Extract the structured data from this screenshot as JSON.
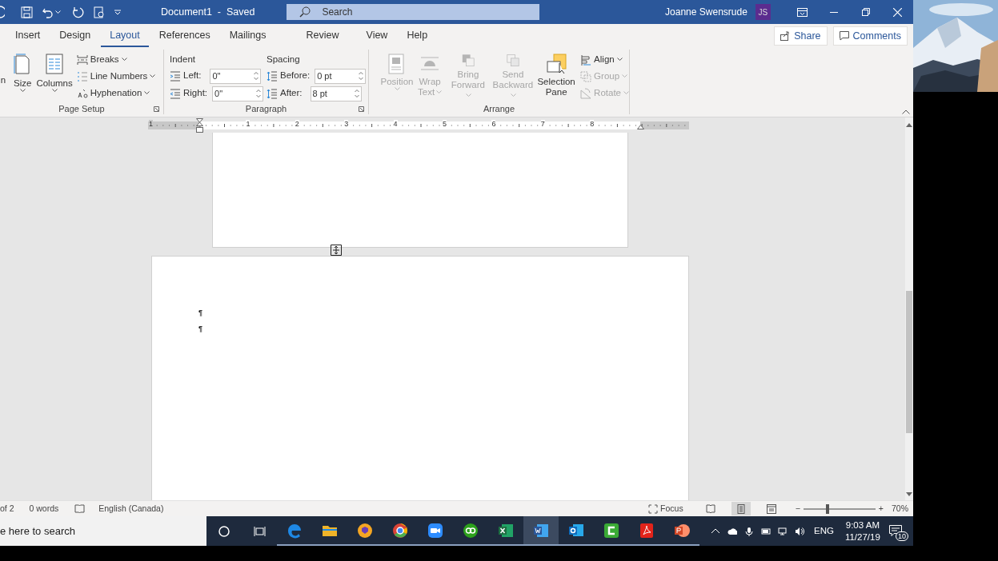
{
  "title_bar": {
    "document_title": "Document1  -  Saved",
    "search_placeholder": "Search",
    "user_name": "Joanne Swensrude",
    "user_initials": "JS"
  },
  "tabs": [
    {
      "label": "Insert",
      "selected": false
    },
    {
      "label": "Design",
      "selected": false
    },
    {
      "label": "Layout",
      "selected": true
    },
    {
      "label": "References",
      "selected": false
    },
    {
      "label": "Mailings",
      "selected": false
    },
    {
      "label": "Review",
      "selected": false
    },
    {
      "label": "View",
      "selected": false
    },
    {
      "label": "Help",
      "selected": false
    }
  ],
  "share": "Share",
  "comments": "Comments",
  "page_setup": {
    "cut_button": "n",
    "large": [
      {
        "label": "Size"
      },
      {
        "label": "Columns"
      }
    ],
    "small": [
      {
        "label": "Breaks"
      },
      {
        "label": "Line Numbers"
      },
      {
        "label": "Hyphenation"
      }
    ],
    "label": "Page Setup"
  },
  "paragraph": {
    "indent_heading": "Indent",
    "spacing_heading": "Spacing",
    "indent": [
      {
        "label": "Left:",
        "value": "0\""
      },
      {
        "label": "Right:",
        "value": "0\""
      }
    ],
    "spacing": [
      {
        "label": "Before:",
        "value": "0 pt"
      },
      {
        "label": "After:",
        "value": "8 pt"
      }
    ],
    "label": "Paragraph"
  },
  "arrange": {
    "large": [
      {
        "lines": [
          "Position"
        ],
        "disabled": true,
        "dropdown": true
      },
      {
        "lines": [
          "Wrap",
          "Text"
        ],
        "disabled": true,
        "dropdown": true
      },
      {
        "lines": [
          "Bring",
          "Forward"
        ],
        "disabled": true,
        "dropdown": true
      },
      {
        "lines": [
          "Send",
          "Backward"
        ],
        "disabled": true,
        "dropdown": true
      },
      {
        "lines": [
          "Selection",
          "Pane"
        ],
        "disabled": false,
        "dropdown": false
      }
    ],
    "small": [
      {
        "label": "Align",
        "disabled": false
      },
      {
        "label": "Group",
        "disabled": true
      },
      {
        "label": "Rotate",
        "disabled": true
      }
    ],
    "label": "Arrange"
  },
  "ruler": {
    "labels": [
      "1",
      "1",
      "2",
      "3",
      "4",
      "5",
      "6",
      "7",
      "8"
    ]
  },
  "document": {
    "paragraph_marks": [
      "¶",
      "¶"
    ]
  },
  "status_bar": {
    "page": "of 2",
    "words": "0 words",
    "language": "English (Canada)",
    "focus": "Focus",
    "views": [
      {
        "selected": false
      },
      {
        "selected": true
      },
      {
        "selected": false
      }
    ],
    "zoom_out": "−",
    "zoom_in": "+",
    "zoom": {
      "level": 0.34
    },
    "zoom_percent": "70%"
  },
  "taskbar": {
    "search_text": "e here to search",
    "apps": [
      {
        "color": "#1e88e5",
        "selected": false
      },
      {
        "color": "#f0b429",
        "selected": false
      },
      {
        "color": "#f5a623",
        "selected": false
      },
      {
        "color": "#db4437",
        "selected": false
      },
      {
        "color": "#2d8cff",
        "selected": false
      },
      {
        "color": "#2ca01c",
        "selected": false
      },
      {
        "color": "#1d6f42",
        "selected": false
      },
      {
        "color": "#2b579a",
        "selected": true
      },
      {
        "color": "#0f6cbd",
        "selected": false
      },
      {
        "color": "#3aaa35",
        "selected": false
      },
      {
        "color": "#e2231a",
        "selected": false
      },
      {
        "color": "#d24726",
        "selected": false
      }
    ],
    "language": "ENG",
    "time": "9:03 AM",
    "date": "11/27/19",
    "notifications": "10"
  }
}
